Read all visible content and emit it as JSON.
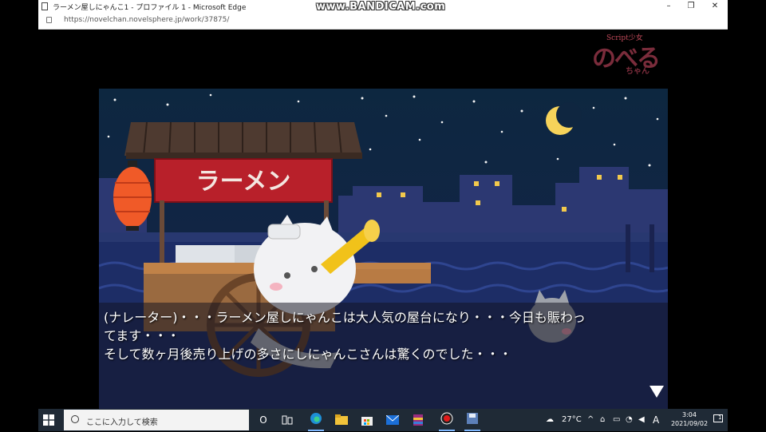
{
  "browser": {
    "window_title": "ラーメン屋しにゃんこ1 - プロファイル 1 - Microsoft Edge",
    "watermark": "www.BANDICAM.com",
    "url": "https://novelchan.novelsphere.jp/work/37875/",
    "controls": {
      "minimize": "–",
      "restore": "❐",
      "close": "✕"
    }
  },
  "logo": {
    "script": "Script少女",
    "main": "のべる",
    "sub": "ちゃん"
  },
  "scene": {
    "stall_sign": "ラーメン",
    "dialog": {
      "lines": [
        "(ナレーター)・・・ラーメン屋しにゃんこは大人気の屋台になり・・・今日も賑わっ",
        "てます・・・",
        "そして数ヶ月後売り上げの多さにしにゃんこさんは驚くのでした・・・"
      ]
    }
  },
  "taskbar": {
    "search_placeholder": "ここに入力して検索",
    "task_view": "O",
    "weather": "27°C",
    "ime": "A",
    "time": "3:04",
    "date": "2021/09/02",
    "notification_count": "1"
  }
}
